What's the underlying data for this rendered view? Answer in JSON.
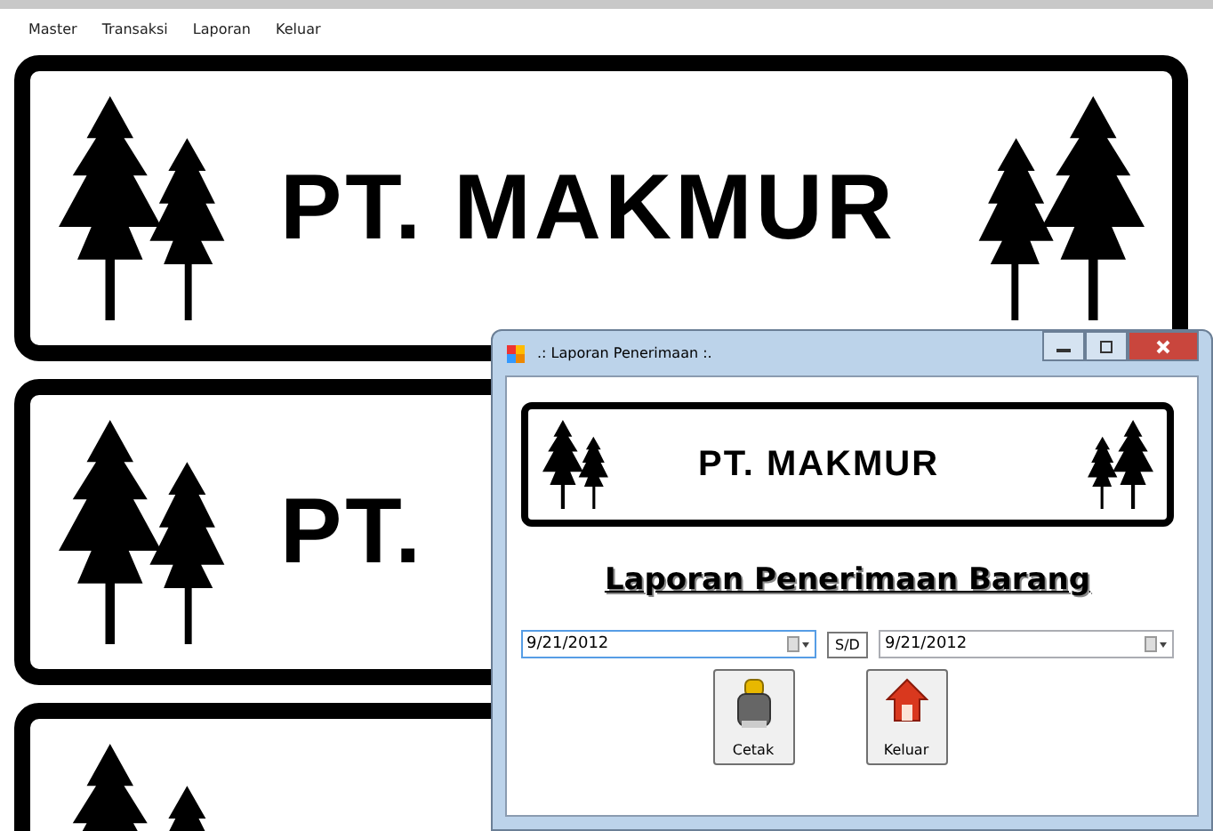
{
  "menu": [
    {
      "label": "Master"
    },
    {
      "label": "Transaksi"
    },
    {
      "label": "Laporan"
    },
    {
      "label": "Keluar"
    }
  ],
  "background_banners": [
    {
      "kind": "logo",
      "text": "PT. MAKMUR"
    },
    {
      "kind": "logo",
      "text": "PT."
    },
    {
      "kind": "logo"
    }
  ],
  "window": {
    "title": ".: Laporan Penerimaan :.",
    "banner": {
      "text": "PT. MAKMUR"
    },
    "heading": "Laporan Penerimaan Barang",
    "date_from": {
      "value": "9/21/2012",
      "focused": true
    },
    "separator": "S/D",
    "date_to": {
      "value": "9/21/2012",
      "focused": false
    },
    "buttons": [
      {
        "kind": "print",
        "label": "Cetak"
      },
      {
        "kind": "exit",
        "label": "Keluar"
      }
    ]
  }
}
